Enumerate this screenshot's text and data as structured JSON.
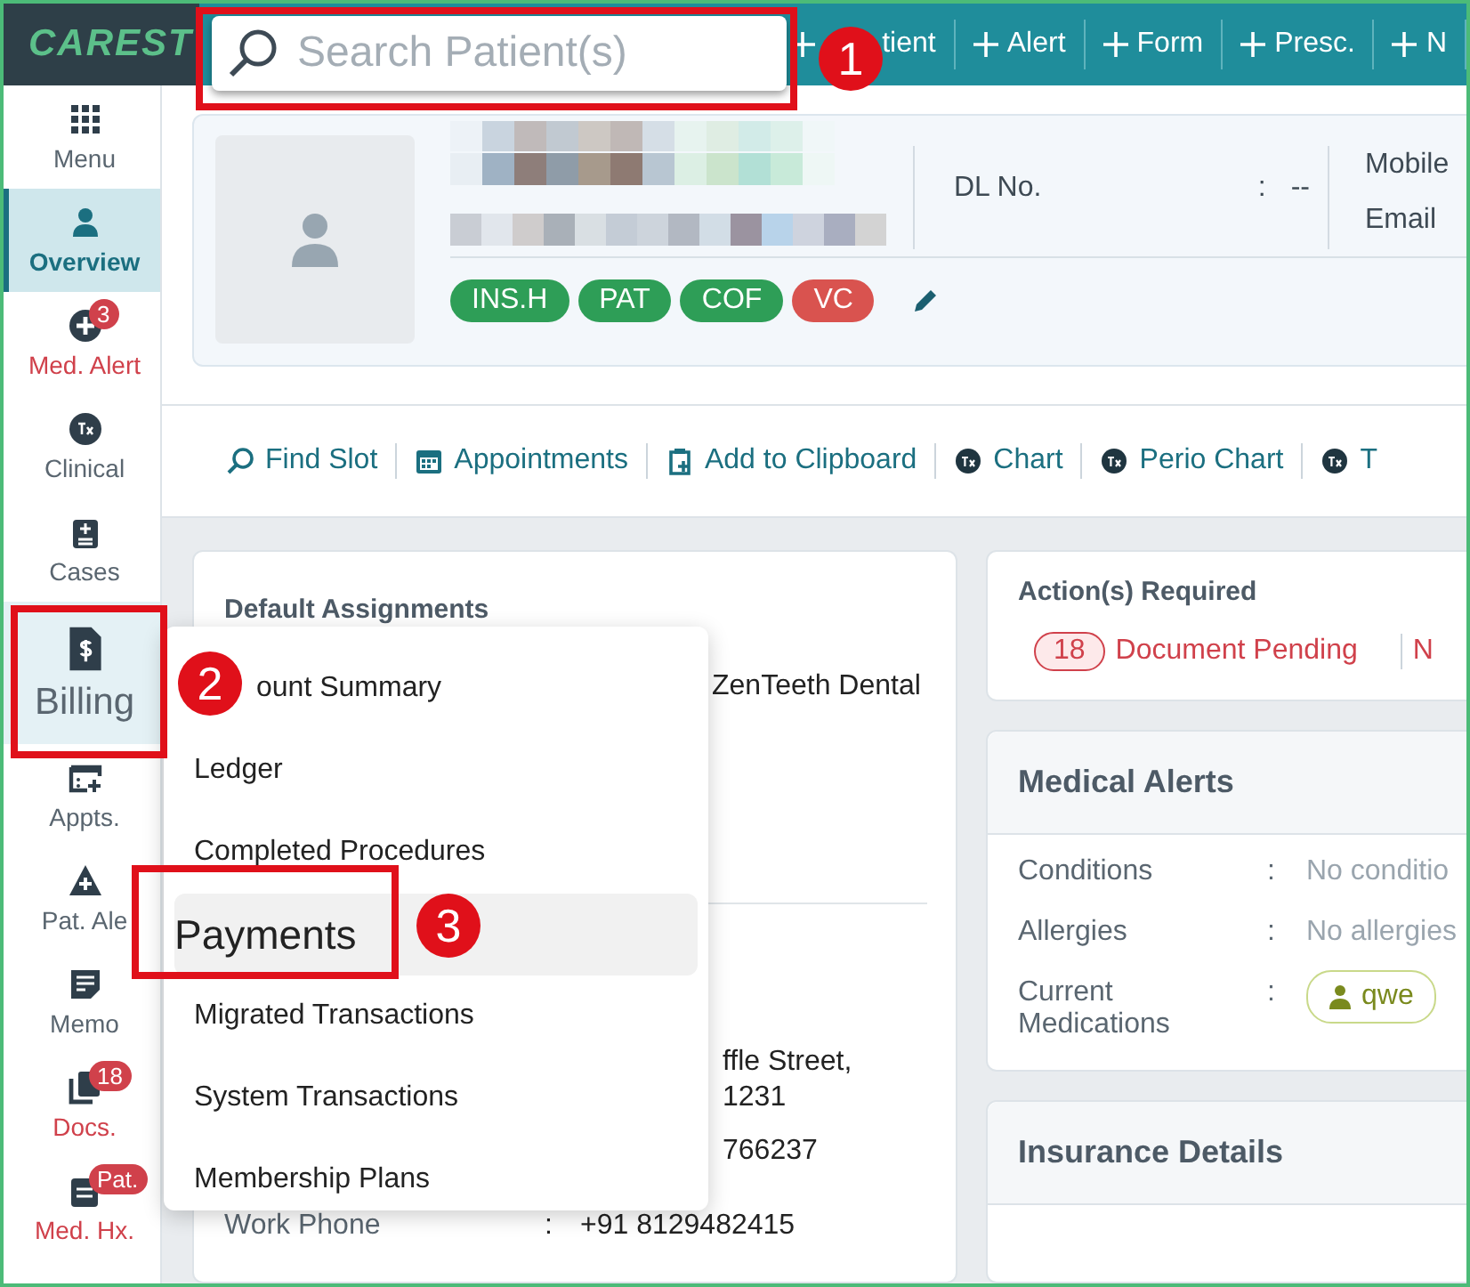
{
  "top_bar": {
    "logo": "CAREST",
    "search": {
      "placeholder": "Search Patient(s)"
    },
    "actions": [
      {
        "label": "tient"
      },
      {
        "label": "Alert"
      },
      {
        "label": "Form"
      },
      {
        "label": "Presc."
      },
      {
        "label": "N"
      }
    ]
  },
  "sidebar": {
    "items": [
      {
        "label": "Menu",
        "kind": "menu",
        "selected": false,
        "hovered": false,
        "alert": false
      },
      {
        "label": "Overview",
        "kind": "overview",
        "selected": true,
        "hovered": false,
        "alert": false
      },
      {
        "label": "Med. Alert",
        "kind": "med-alert",
        "selected": false,
        "hovered": false,
        "alert": true,
        "badge": "3"
      },
      {
        "label": "Clinical",
        "kind": "clinical",
        "selected": false,
        "hovered": false,
        "alert": false
      },
      {
        "label": "Cases",
        "kind": "cases",
        "selected": false,
        "hovered": false,
        "alert": false
      },
      {
        "label": "Billing",
        "kind": "billing",
        "selected": false,
        "hovered": true,
        "alert": false
      },
      {
        "label": "Appts.",
        "kind": "appts",
        "selected": false,
        "hovered": false,
        "alert": false
      },
      {
        "label": "Pat. Ale",
        "kind": "pat-alert",
        "selected": false,
        "hovered": false,
        "alert": false
      },
      {
        "label": "Memo",
        "kind": "memo",
        "selected": false,
        "hovered": false,
        "alert": false
      },
      {
        "label": "Docs.",
        "kind": "docs",
        "selected": false,
        "hovered": false,
        "alert": true,
        "badge": "18"
      },
      {
        "label": "Med. Hx.",
        "kind": "med-hx",
        "selected": false,
        "hovered": false,
        "alert": true,
        "badge": "Pat."
      }
    ]
  },
  "patient_card": {
    "dl_label": "DL No.",
    "separator": ":",
    "dl_value": "--",
    "contact_labels": [
      "Mobile",
      "Email"
    ],
    "tags": [
      {
        "label": "INS.H",
        "color": "#2e9e57"
      },
      {
        "label": "PAT",
        "color": "#2e9e57"
      },
      {
        "label": "COF",
        "color": "#2e9e57"
      },
      {
        "label": "VC",
        "color": "#d9534f"
      }
    ]
  },
  "quick_actions": [
    {
      "label": "Find Slot",
      "kind": "search"
    },
    {
      "label": "Appointments",
      "kind": "calendar"
    },
    {
      "label": "Add to Clipboard",
      "kind": "clipboard"
    },
    {
      "label": "Chart",
      "kind": "tx"
    },
    {
      "label": "Perio Chart",
      "kind": "tx"
    },
    {
      "label": "T",
      "kind": "tx"
    }
  ],
  "assignments_card": {
    "title": "Default Assignments",
    "lines": [
      "ZenTeeth Dental"
    ],
    "address_lines": [
      "ffle Street,",
      "1231",
      "766237"
    ],
    "work_phone": {
      "label": "Work Phone",
      "separator": ":",
      "value": "+91 8129482415"
    }
  },
  "billing_menu": {
    "items": [
      {
        "label": "ount Summary",
        "selected": false
      },
      {
        "label": "Ledger",
        "selected": false
      },
      {
        "label": "Completed Procedures",
        "selected": false
      },
      {
        "label": "Payments",
        "selected": true
      },
      {
        "label": "Migrated Transactions",
        "selected": false
      },
      {
        "label": "System Transactions",
        "selected": false
      },
      {
        "label": "Membership Plans",
        "selected": false
      }
    ]
  },
  "actions_required": {
    "title": "Action(s) Required",
    "count": "18",
    "label": "Document Pending",
    "next": "N"
  },
  "medical_alerts": {
    "title": "Medical Alerts",
    "rows": [
      {
        "label": "Conditions",
        "separator": ":",
        "value": "No conditio"
      },
      {
        "label": "Allergies",
        "separator": ":",
        "value": "No allergies"
      },
      {
        "label": "Current Medications",
        "separator": ":",
        "chips": [
          "qwe"
        ]
      }
    ]
  },
  "insurance": {
    "title": "Insurance Details"
  },
  "callouts": [
    "1",
    "2",
    "3"
  ]
}
